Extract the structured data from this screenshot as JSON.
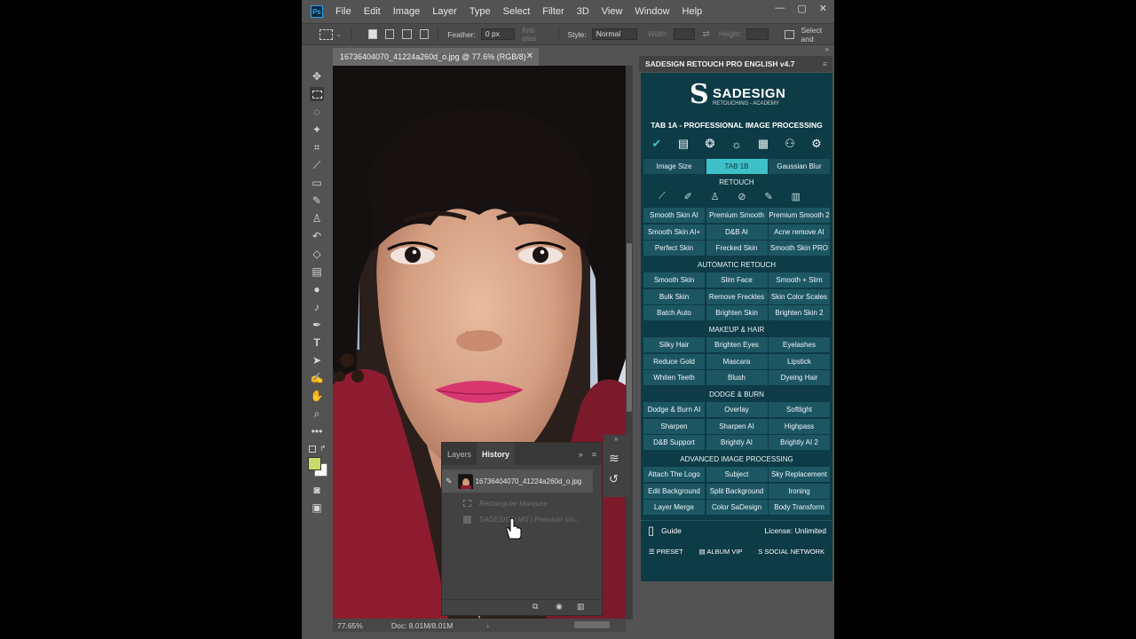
{
  "app": {
    "logo_text": "Ps",
    "menus": [
      "File",
      "Edit",
      "Image",
      "Layer",
      "Type",
      "Select",
      "Filter",
      "3D",
      "View",
      "Window",
      "Help"
    ],
    "window_controls": [
      "—",
      "▢",
      "✕"
    ]
  },
  "options": {
    "feather_label": "Feather:",
    "feather_value": "0 px",
    "antialias_label": "Anti-alias",
    "style_label": "Style:",
    "style_value": "Normal",
    "width_label": "Width:",
    "height_label": "Height:",
    "select_mask_label": "Select and"
  },
  "toolbar": {
    "icons": [
      "move-icon",
      "rect-marquee-icon",
      "lasso-icon",
      "magic-wand-icon",
      "crop-icon",
      "eyedropper-icon",
      "healing-brush-icon",
      "brush-icon",
      "clone-stamp-icon",
      "history-brush-icon",
      "eraser-icon",
      "gradient-icon",
      "blur-icon",
      "dodge-icon",
      "pen-icon",
      "type-icon",
      "path-select-icon",
      "shape-icon",
      "hand-icon",
      "zoom-icon",
      "more-icon"
    ],
    "foreground_color": "#c8dc6a",
    "background_color": "#ffffff"
  },
  "document": {
    "tab_title": "16736404070_41224a260d_o.jpg @ 77.6% (RGB/8) *",
    "zoom": "77.65%",
    "doc_size": "Doc: 8.01M/8.01M"
  },
  "history_panel": {
    "tabs": [
      "Layers",
      "History"
    ],
    "active_tab": "History",
    "snapshot_label": "16736404070_41224a260d_o.jpg",
    "entries": [
      "Rectangular Marquee",
      "SADESIGN MS | Premium sm..."
    ]
  },
  "sadesign": {
    "panel_title": "SADESIGN RETOUCH PRO ENGLISH v4.7",
    "brand_name": "SADESIGN",
    "brand_sub": "RETOUCHING - ACADEMY",
    "tab_title": "TAB 1A - PROFESSIONAL IMAGE PROCESSING",
    "tab_row": [
      "Image Size",
      "TAB 1B",
      "Gaussian Blur"
    ],
    "sections": [
      {
        "title": "RETOUCH",
        "buttons": [
          "Smooth Skin AI",
          "Premium Smooth",
          "Premium Smooth 2",
          "Smooth Skin AI+",
          "D&B AI",
          "Acne remove AI",
          "Perfect Skin",
          "Frecked Skin",
          "Smooth Skin PRO"
        ]
      },
      {
        "title": "AUTOMATIC RETOUCH",
        "buttons": [
          "Smooth Skin",
          "Slim Face",
          "Smooth + Slim",
          "Bulk Skin",
          "Remove Freckles",
          "Skin Color Scales",
          "Batch Auto",
          "Brighten Skin",
          "Brighten Skin 2"
        ]
      },
      {
        "title": "MAKEUP & HAIR",
        "buttons": [
          "Silky Hair",
          "Brighten Eyes",
          "Eyelashes",
          "Reduce Gold",
          "Mascara",
          "Lipstick",
          "Whiten Teeth",
          "Blush",
          "Dyeing Hair"
        ]
      },
      {
        "title": "DODGE & BURN",
        "buttons": [
          "Dodge & Burn AI",
          "Overlay",
          "Softlight",
          "Sharpen",
          "Sharpen AI",
          "Highpass",
          "D&B Support",
          "Brightly AI",
          "Brightly AI 2"
        ]
      },
      {
        "title": "ADVANCED IMAGE PROCESSING",
        "buttons": [
          "Attach The Logo",
          "Subject",
          "Sky Replacement",
          "Edit Background",
          "Split Background",
          "Ironing",
          "Layer Merge",
          "Color SaDesign",
          "Body Transform"
        ]
      }
    ],
    "guide_label": "Guide",
    "license_text": "License: Unlimited",
    "footer": [
      "PRESET",
      "ALBUM VIP",
      "SOCIAL NETWORK"
    ],
    "accent_color": "#3fc0c9",
    "panel_bg": "#0d3b46",
    "button_bg": "#1d5663"
  }
}
